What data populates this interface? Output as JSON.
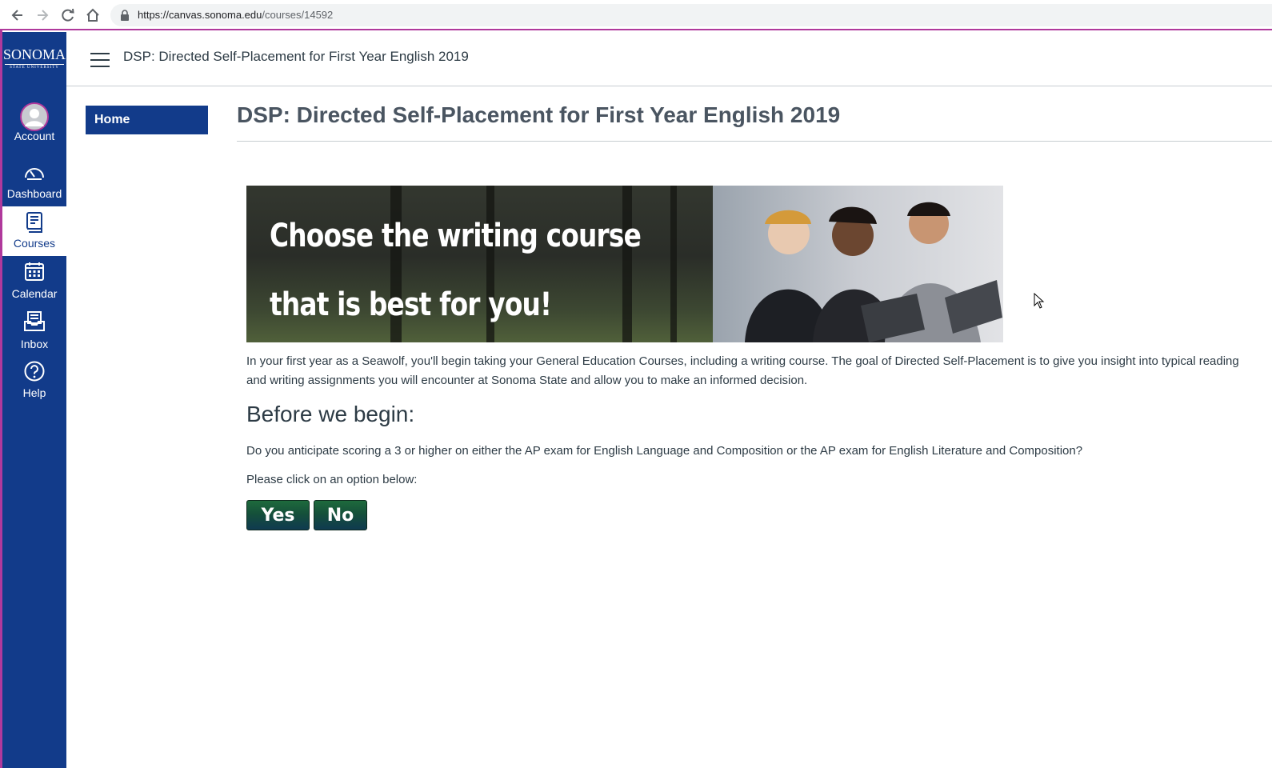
{
  "browser": {
    "url_host": "https://canvas.sonoma.edu",
    "url_path": "/courses/14592"
  },
  "global_nav": {
    "logo_word": "SONOMA",
    "logo_sub": "STATE UNIVERSITY",
    "items": [
      {
        "label": "Account",
        "icon": "account-icon",
        "active": false
      },
      {
        "label": "Dashboard",
        "icon": "dashboard-icon",
        "active": false
      },
      {
        "label": "Courses",
        "icon": "courses-icon",
        "active": true
      },
      {
        "label": "Calendar",
        "icon": "calendar-icon",
        "active": false
      },
      {
        "label": "Inbox",
        "icon": "inbox-icon",
        "active": false
      },
      {
        "label": "Help",
        "icon": "help-icon",
        "active": false
      }
    ]
  },
  "header": {
    "title": "DSP: Directed Self-Placement for First Year English 2019"
  },
  "course_nav": {
    "home_label": "Home"
  },
  "main": {
    "title": "DSP: Directed Self-Placement for First Year English 2019",
    "banner_line1": "Choose the writing course",
    "banner_line2": "that is best for you!",
    "intro": "In your first year as a Seawolf, you'll begin taking your General Education Courses, including a writing course. The goal of Directed Self-Placement is to give you insight into typical reading and writing assignments you will encounter at Sonoma State and allow you to make an informed decision.",
    "subheading": "Before we begin:",
    "question": "Do you anticipate scoring a 3 or higher on either the AP exam for English Language and Composition or the AP exam for English Literature and Composition?",
    "instruction": "Please click on an option below:",
    "yes_label": "Yes",
    "no_label": "No"
  },
  "colors": {
    "nav_blue": "#123b8a",
    "accent_magenta": "#b0399c",
    "button_green": "#15503a"
  }
}
